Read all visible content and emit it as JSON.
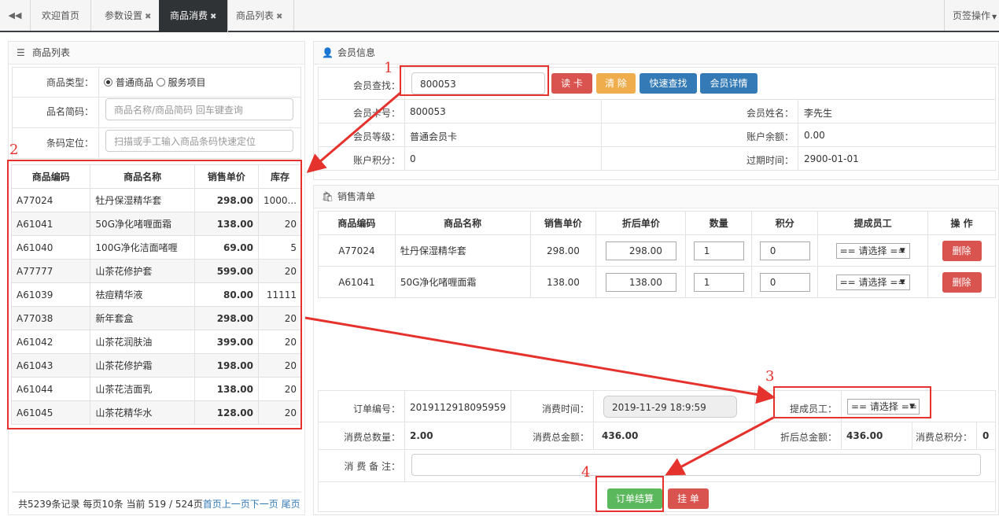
{
  "tabs": {
    "items": [
      {
        "label": "欢迎首页",
        "closable": false
      },
      {
        "label": "参数设置",
        "closable": true
      },
      {
        "label": "商品消费",
        "closable": true
      },
      {
        "label": "商品列表",
        "closable": true
      }
    ],
    "ops": "页签操作",
    "close": "✖"
  },
  "product_panel": {
    "title": "商品列表",
    "type_label": "商品类型：",
    "type_options": [
      "普通商品",
      "服务项目"
    ],
    "name_label": "品名简码：",
    "name_placeholder": "商品名称/商品简码 回车键查询",
    "barcode_label": "条码定位：",
    "barcode_placeholder": "扫描或手工输入商品条码快速定位",
    "columns": [
      "商品编码",
      "商品名称",
      "销售单价",
      "库存"
    ],
    "rows": [
      [
        "A77024",
        "牡丹保湿精华套",
        "298.00",
        "1000..."
      ],
      [
        "A61041",
        "50G净化啫喱面霜",
        "138.00",
        "20"
      ],
      [
        "A61040",
        "100G净化洁面啫喱",
        "69.00",
        "5"
      ],
      [
        "A77777",
        "山茶花修护套",
        "599.00",
        "20"
      ],
      [
        "A61039",
        "祛痘精华液",
        "80.00",
        "11111"
      ],
      [
        "A77038",
        "新年套盒",
        "298.00",
        "20"
      ],
      [
        "A61042",
        "山茶花润肤油",
        "399.00",
        "20"
      ],
      [
        "A61043",
        "山茶花修护霜",
        "198.00",
        "20"
      ],
      [
        "A61044",
        "山茶花洁面乳",
        "138.00",
        "20"
      ],
      [
        "A61045",
        "山茶花精华水",
        "128.00",
        "20"
      ]
    ],
    "pager_text": "共5239条记录 每页10条 当前 519 / 524页",
    "pager_links": [
      "首页",
      "上一页",
      "下一页",
      "尾页"
    ]
  },
  "member_panel": {
    "title": "会员信息",
    "search_label": "会员查找：",
    "search_value": "800053",
    "buttons": [
      "读 卡",
      "清 除",
      "快速查找",
      "会员详情"
    ],
    "fields": [
      {
        "l": "会员卡号：",
        "v": "800053"
      },
      {
        "l": "会员姓名：",
        "v": "李先生"
      },
      {
        "l": "会员等级：",
        "v": "普通会员卡"
      },
      {
        "l": "账户余额：",
        "v": "0.00"
      },
      {
        "l": "账户积分：",
        "v": "0"
      },
      {
        "l": "过期时间：",
        "v": "2900-01-01"
      }
    ]
  },
  "sales_panel": {
    "title": "销售清单",
    "columns": [
      "商品编码",
      "商品名称",
      "销售单价",
      "折后单价",
      "数量",
      "积分",
      "提成员工",
      "操 作"
    ],
    "rows": [
      {
        "code": "A77024",
        "name": "牡丹保湿精华套",
        "price": "298.00",
        "discount": "298.00",
        "qty": "1",
        "points": "0",
        "staff": "== 请选择 ==",
        "op": "删除"
      },
      {
        "code": "A61041",
        "name": "50G净化啫喱面霜",
        "price": "138.00",
        "discount": "138.00",
        "qty": "1",
        "points": "0",
        "staff": "== 请选择 ==",
        "op": "删除"
      }
    ]
  },
  "order": {
    "no_label": "订单编号：",
    "no": "2019112918095959",
    "time_label": "消费时间：",
    "time": "2019-11-29 18:9:59",
    "staff_label": "提成员工：",
    "staff": "== 请选择 ==",
    "qty_label": "消费总数量：",
    "qty": "2.00",
    "amount_label": "消费总金额：",
    "amount": "436.00",
    "disc_label": "折后总金额：",
    "disc": "436.00",
    "points_label": "消费总积分：",
    "points": "0",
    "note_label": "消 费 备 注：",
    "settle": "订单结算",
    "hold": "挂 单"
  },
  "annotations": [
    "1",
    "2",
    "3",
    "4"
  ],
  "colors": {
    "annotation": "#e5322d",
    "accent_dark": "#2f3336"
  }
}
